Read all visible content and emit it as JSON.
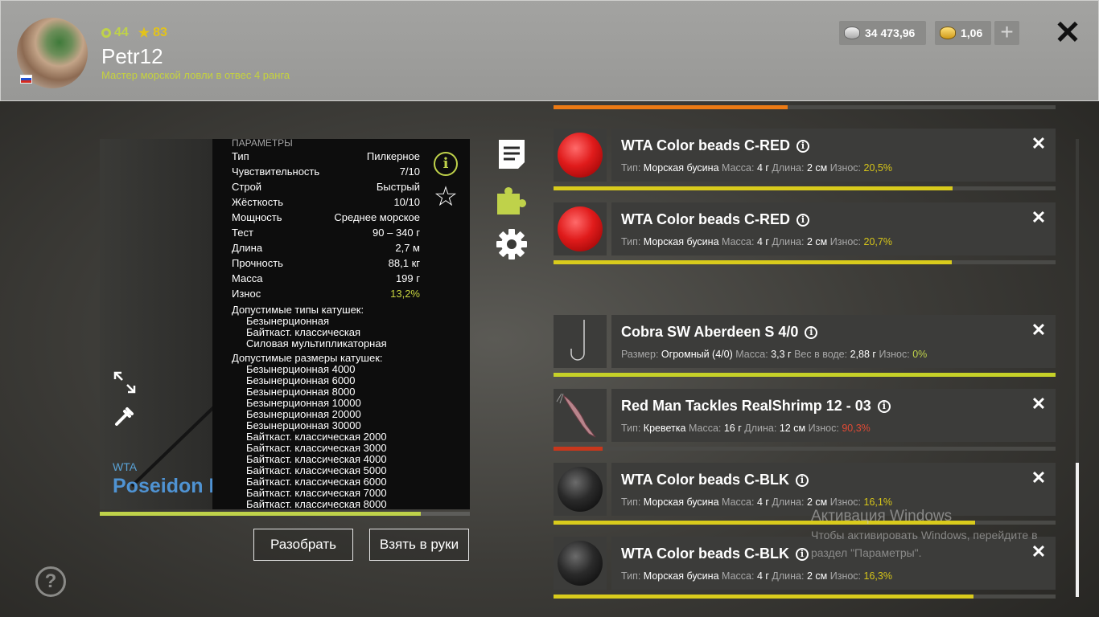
{
  "header": {
    "level": "44",
    "rank": "83",
    "player_name": "Petr12",
    "player_title": "Мастер морской ловли в отвес 4 ранга",
    "silver": "34 473,96",
    "gold": "1,06"
  },
  "rod": {
    "brand": "WTA",
    "model": "Poseidon Me",
    "params_title": "ПАРАМЕТРЫ",
    "params": [
      {
        "label": "Тип",
        "value": "Пилкерное"
      },
      {
        "label": "Чувствительность",
        "value": "7/10"
      },
      {
        "label": "Строй",
        "value": "Быстрый"
      },
      {
        "label": "Жёсткость",
        "value": "10/10"
      },
      {
        "label": "Мощность",
        "value": "Среднее морское"
      },
      {
        "label": "Тест",
        "value": "90 – 340 г"
      },
      {
        "label": "Длина",
        "value": "2,7 м"
      },
      {
        "label": "Прочность",
        "value": "88,1 кг"
      },
      {
        "label": "Масса",
        "value": "199 г"
      },
      {
        "label": "Износ",
        "value": "13,2%"
      }
    ],
    "reel_types_title": "Допустимые типы катушек:",
    "reel_types": [
      "Безынерционная",
      "Байткаст. классическая",
      "Силовая мультипликаторная"
    ],
    "reel_sizes_title": "Допустимые размеры катушек:",
    "reel_sizes": [
      "Безынерционная 4000",
      "Безынерционная 6000",
      "Безынерционная 8000",
      "Безынерционная 10000",
      "Безынерционная 20000",
      "Безынерционная 30000",
      "Байткаст. классическая 2000",
      "Байткаст. классическая 3000",
      "Байткаст. классическая 4000",
      "Байткаст. классическая 5000",
      "Байткаст. классическая 6000",
      "Байткаст. классическая 7000",
      "Байткаст. классическая 8000"
    ],
    "wear_remaining": 0.868,
    "disassemble_label": "Разобрать",
    "equip_label": "Взять в руки"
  },
  "items": [
    {
      "name": "WTA Color beads C-RED",
      "thumb": "red-bead",
      "details": [
        [
          "Тип:",
          "Морская бусина"
        ],
        [
          "Масса:",
          "4 г"
        ],
        [
          "Длина:",
          "2 см"
        ]
      ],
      "wear_label": "Износ:",
      "wear": "20,5%",
      "wear_color": "#d7c619",
      "condition": 0.795
    },
    {
      "name": "WTA Color beads C-RED",
      "thumb": "red-bead",
      "details": [
        [
          "Тип:",
          "Морская бусина"
        ],
        [
          "Масса:",
          "4 г"
        ],
        [
          "Длина:",
          "2 см"
        ]
      ],
      "wear_label": "Износ:",
      "wear": "20,7%",
      "wear_color": "#d7c619",
      "condition": 0.793
    },
    {
      "name": "Cobra SW Aberdeen S 4/0",
      "thumb": "hook",
      "details": [
        [
          "Размер:",
          "Огромный (4/0)"
        ],
        [
          "Масса:",
          "3,3 г"
        ],
        [
          "Вес в воде:",
          "2,88 г"
        ]
      ],
      "wear_label": "Износ:",
      "wear": "0%",
      "wear_color": "#bfd24a",
      "condition": 1.0
    },
    {
      "name": "Red Man Tackles RealShrimp 12 - 03",
      "thumb": "shrimp",
      "details": [
        [
          "Тип:",
          "Креветка"
        ],
        [
          "Масса:",
          "16 г"
        ],
        [
          "Длина:",
          "12 см"
        ]
      ],
      "wear_label": "Износ:",
      "wear": "90,3%",
      "wear_color": "#e04a35",
      "condition": 0.097
    },
    {
      "name": "WTA Color beads C-BLK",
      "thumb": "black-bead",
      "details": [
        [
          "Тип:",
          "Морская бусина"
        ],
        [
          "Масса:",
          "4 г"
        ],
        [
          "Длина:",
          "2 см"
        ]
      ],
      "wear_label": "Износ:",
      "wear": "16,1%",
      "wear_color": "#d7c619",
      "condition": 0.839
    },
    {
      "name": "WTA Color beads C-BLK",
      "thumb": "black-bead",
      "details": [
        [
          "Тип:",
          "Морская бусина"
        ],
        [
          "Масса:",
          "4 г"
        ],
        [
          "Длина:",
          "2 см"
        ]
      ],
      "wear_label": "Износ:",
      "wear": "16,3%",
      "wear_color": "#d7c619",
      "condition": 0.837
    }
  ],
  "watermark": {
    "line1": "Активация Windows",
    "line2": "Чтобы активировать Windows, перейдите в",
    "line3": "раздел \"Параметры\"."
  }
}
